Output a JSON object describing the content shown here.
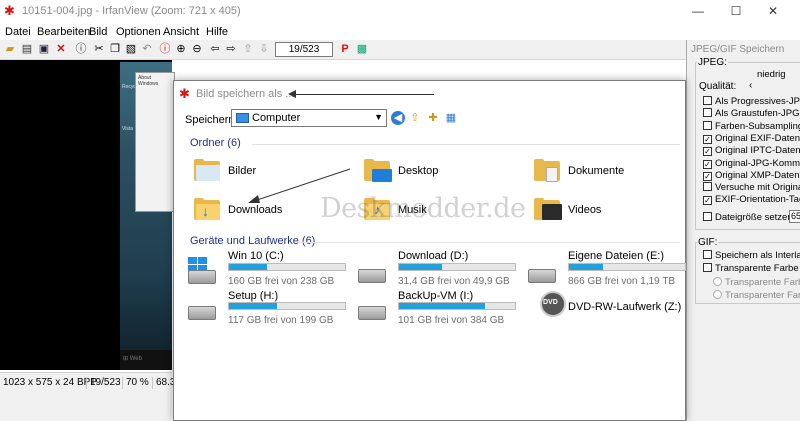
{
  "window": {
    "title": "10151-004.jpg - IrfanView (Zoom: 721 x 405)",
    "minimize_glyph": "—",
    "maximize_glyph": "☐",
    "close_glyph": "✕"
  },
  "menu": [
    "Datei",
    "Bearbeiten",
    "Bild",
    "Optionen",
    "Ansicht",
    "Hilfe"
  ],
  "toolbar": {
    "page_counter": "19/523"
  },
  "screenshot_content": {
    "window_title": "About Windows",
    "desktop_icon_1": "Recyc",
    "desktop_icon_2": "Vista",
    "taskbar_text": "Web"
  },
  "statusbar": {
    "resolution": "1023 x 575 x 24 BPP",
    "index": "19/523",
    "zoom": "70 %",
    "extra": "68.3"
  },
  "jpg_panel": {
    "title": "JPEG/GIF Speichern",
    "jpeg_group": "JPEG:",
    "quality_low": "niedrig",
    "quality_label": "Qualität:",
    "options": [
      {
        "label": "Als Progressives-JPG sp",
        "checked": false
      },
      {
        "label": "Als Graustufen-JPG spei",
        "checked": false
      },
      {
        "label": "Farben-Subsampling dea",
        "checked": false
      },
      {
        "label": "Original EXIF-Daten beh",
        "checked": true
      },
      {
        "label": "Original IPTC-Daten beh",
        "checked": true
      },
      {
        "label": "Original-JPG-Kommentar",
        "checked": true
      },
      {
        "label": "Original XMP-Daten beh",
        "checked": true
      },
      {
        "label": "Versuche mit Original-JP",
        "checked": false
      },
      {
        "label": "EXIF-Orientation-Tag zur",
        "checked": true
      }
    ],
    "filesize_label": "Dateigröße setzen:",
    "filesize_value": "65",
    "gif_group": "GIF:",
    "gif_options": [
      {
        "label": "Speichern als Interlaced",
        "checked": false
      },
      {
        "label": "Transparente Farbe spei",
        "checked": false
      }
    ],
    "gif_radios": [
      "Transparente Farbe",
      "Transparenter Farbe"
    ]
  },
  "dialog": {
    "title": "Bild speichern als ...",
    "save_in_label": "Speichern",
    "save_in_value": "Computer",
    "folders_header": "Ordner (6)",
    "folders": [
      "Bilder",
      "Desktop",
      "Dokumente",
      "Downloads",
      "Musik",
      "Videos"
    ],
    "drives_header": "Geräte und Laufwerke (6)",
    "drives": [
      {
        "name": "Win 10 (C:)",
        "free": "160 GB frei von 238 GB",
        "used": 0.33
      },
      {
        "name": "Download (D:)",
        "free": "31,4 GB frei von 49,9 GB",
        "used": 0.37
      },
      {
        "name": "Eigene Dateien (E:)",
        "free": "866 GB frei von 1,19 TB",
        "used": 0.29
      },
      {
        "name": "Setup (H:)",
        "free": "117 GB frei von 199 GB",
        "used": 0.41
      },
      {
        "name": "BackUp-VM (I:)",
        "free": "101 GB frei von 384 GB",
        "used": 0.74
      }
    ],
    "dvd": {
      "name": "DVD-RW-Laufwerk (Z:)",
      "label": "DVD"
    }
  },
  "watermark": "Deskmodder.de"
}
